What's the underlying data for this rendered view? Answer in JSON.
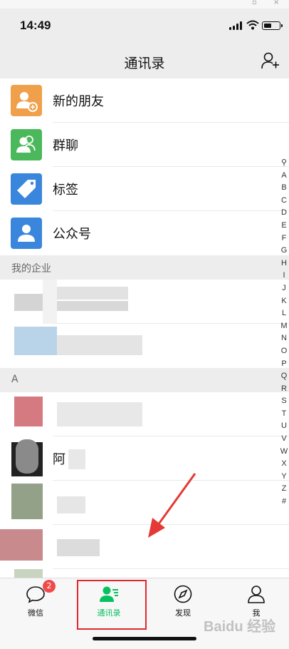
{
  "status": {
    "time": "14:49"
  },
  "header": {
    "title": "通讯录"
  },
  "fixed_items": [
    {
      "label": "新的朋友",
      "color": "#f0a04b"
    },
    {
      "label": "群聊",
      "color": "#4cb85c"
    },
    {
      "label": "标签",
      "color": "#3a86dc"
    },
    {
      "label": "公众号",
      "color": "#3a86dc"
    }
  ],
  "sections": {
    "enterprise": "我的企业",
    "a": "A"
  },
  "contacts_a_first_visible_char": "阿",
  "index_letters": [
    "A",
    "B",
    "C",
    "D",
    "E",
    "F",
    "G",
    "H",
    "I",
    "J",
    "K",
    "L",
    "M",
    "N",
    "O",
    "P",
    "Q",
    "R",
    "S",
    "T",
    "U",
    "V",
    "W",
    "X",
    "Y",
    "Z",
    "#"
  ],
  "tabs": [
    {
      "label": "微信",
      "badge": "2"
    },
    {
      "label": "通讯录",
      "active": true
    },
    {
      "label": "发现"
    },
    {
      "label": "我"
    }
  ],
  "colors": {
    "accent": "#07c160",
    "highlight_box": "#e0282c",
    "arrow": "#e53935"
  },
  "watermark": "Baidu 经验"
}
